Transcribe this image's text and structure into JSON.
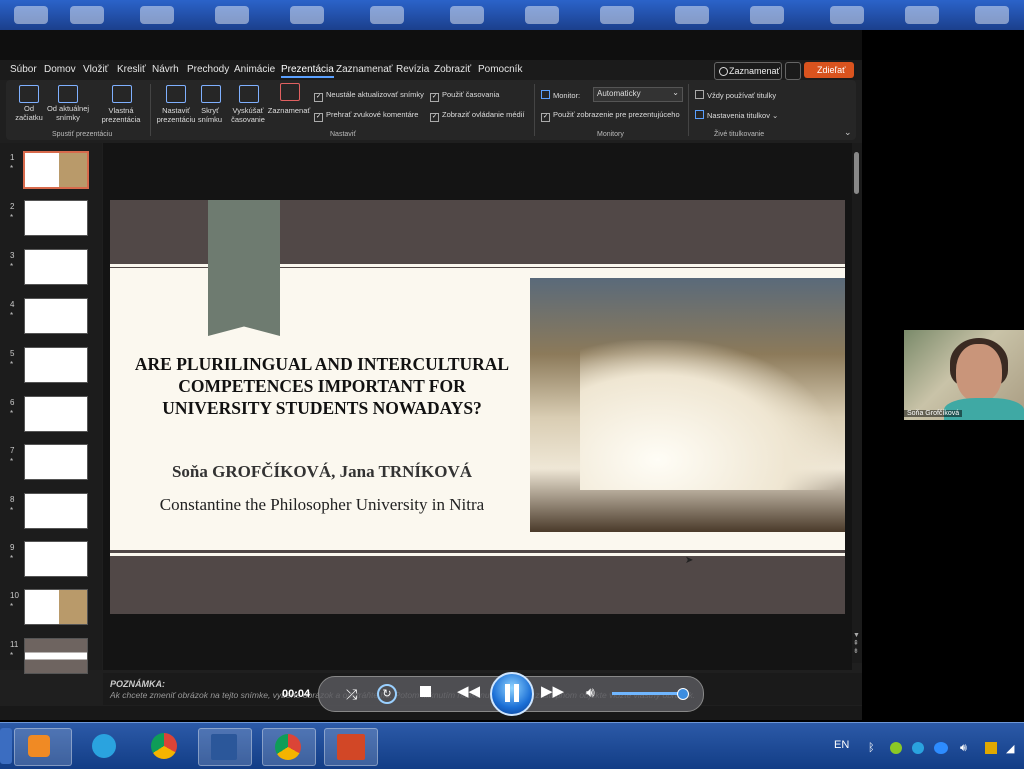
{
  "menu": {
    "items": [
      "Súbor",
      "Domov",
      "Vložiť",
      "Kresliť",
      "Návrh",
      "Prechody",
      "Animácie",
      "Prezentácia",
      "Zaznamenať",
      "Revízia",
      "Zobraziť",
      "Pomocník"
    ],
    "active": "Prezentácia",
    "record_label": "Zaznamenať",
    "share_label": "Zdieľať"
  },
  "ribbon": {
    "from_start": "Od začiatku",
    "from_current": "Od aktuálnej snímky",
    "custom_show": "Vlastná prezentácia",
    "group_start": "Spustiť prezentáciu",
    "setup": "Nastaviť prezentáciu",
    "hide_slide": "Skryť snímku",
    "rehearse": "Vyskúšať časovanie",
    "record": "Zaznamenať",
    "chk_update": "Neustále aktualizovať snímky",
    "chk_narrations": "Prehrať zvukové komentáre",
    "chk_timings": "Použiť časovania",
    "chk_media": "Zobraziť ovládanie médií",
    "group_setup": "Nastaviť",
    "monitor_label": "Monitor:",
    "monitor_value": "Automaticky",
    "presenter_view": "Použiť zobrazenie pre prezentujúceho",
    "group_monitors": "Monitory",
    "always_captions": "Vždy používať titulky",
    "caption_settings": "Nastavenia titulkov",
    "group_captions": "Živé titulkovanie"
  },
  "thumbnails": [
    "1",
    "2",
    "3",
    "4",
    "5",
    "6",
    "7",
    "8",
    "9",
    "10",
    "11"
  ],
  "slide": {
    "title_line1": "ARE PLURILINGUAL AND INTERCULTURAL",
    "title_line2": "COMPETENCES IMPORTANT FOR",
    "title_line3": "UNIVERSITY STUDENTS NOWADAYS?",
    "authors": "Soňa GROFČÍKOVÁ, Jana TRNÍKOVÁ",
    "university": "Constantine the Philosopher University in Nitra"
  },
  "webcam": {
    "name": "Soňa Grofčíková"
  },
  "notes": {
    "title": "POZNÁMKA:",
    "text": "Ak chcete zmeniť obrázok na tejto snímke, vyberte obrázok a odstráňte ho. Potom kliknutím na ikonu obrázkov v zástupnom objekte vložte vlastný obrázok."
  },
  "media": {
    "time": "00:04",
    "volume_fraction": 0.95
  },
  "taskbar": {
    "language": "EN"
  },
  "colors": {
    "accent_orange": "#d9531e",
    "slide_bg": "#514847",
    "slide_band": "#fbf8ef",
    "bookmark": "#6e7b70"
  }
}
